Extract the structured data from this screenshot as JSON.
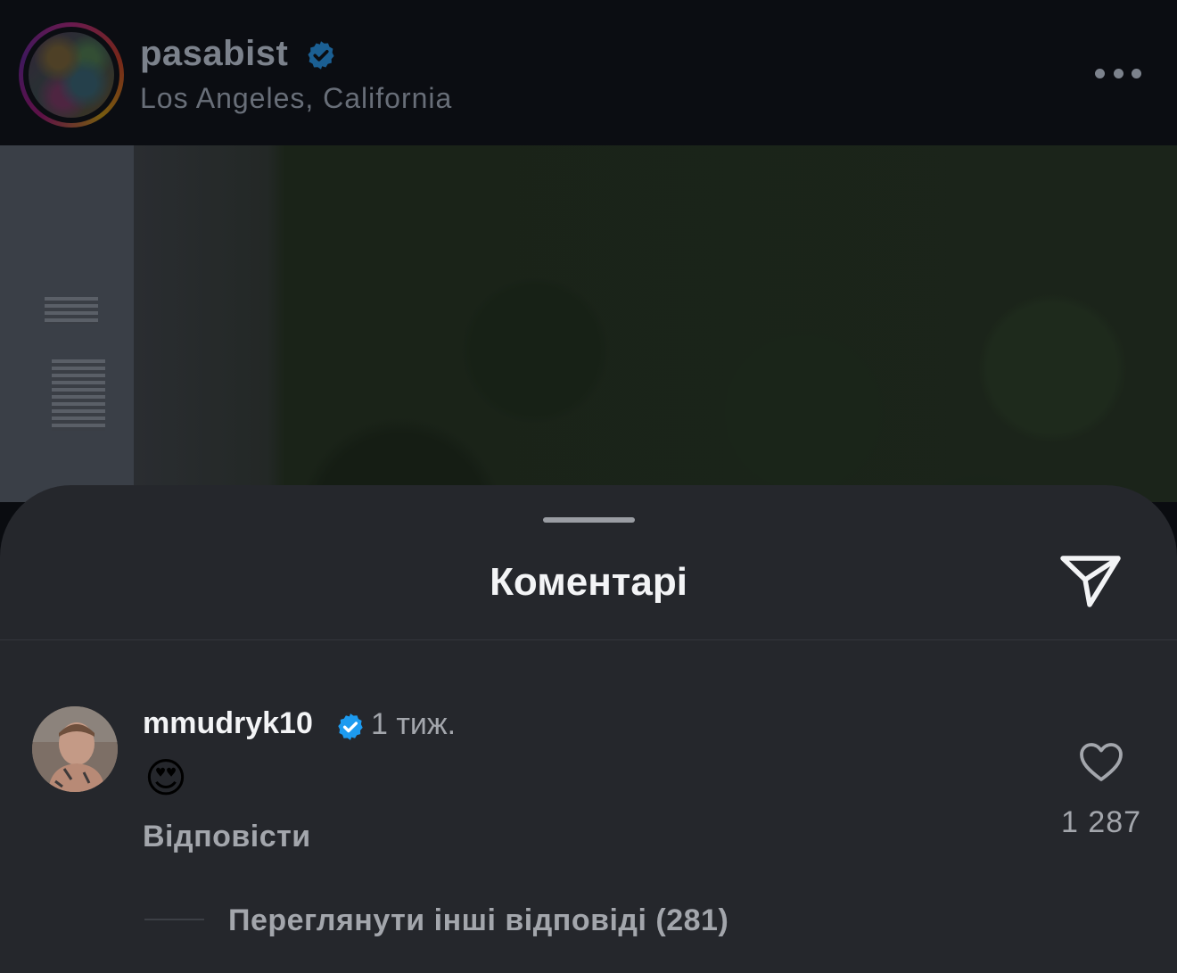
{
  "post": {
    "username": "pasabist",
    "location": "Los Angeles, California"
  },
  "comments_sheet": {
    "title": "Коментарі"
  },
  "comment": {
    "username": "mmudryk10",
    "time": "1 тиж.",
    "text": "😍",
    "reply_label": "Відповісти",
    "like_count": "1 287",
    "view_replies_label": "Переглянути інші відповіді (281)"
  },
  "icons": {
    "verified": "verified-badge-icon",
    "more": "more-options-icon",
    "share": "paper-plane-icon",
    "like": "heart-icon"
  },
  "colors": {
    "sheet_background": "#25272c",
    "verified_blue": "#1d9bf0",
    "secondary_text": "#a3a6ac"
  }
}
